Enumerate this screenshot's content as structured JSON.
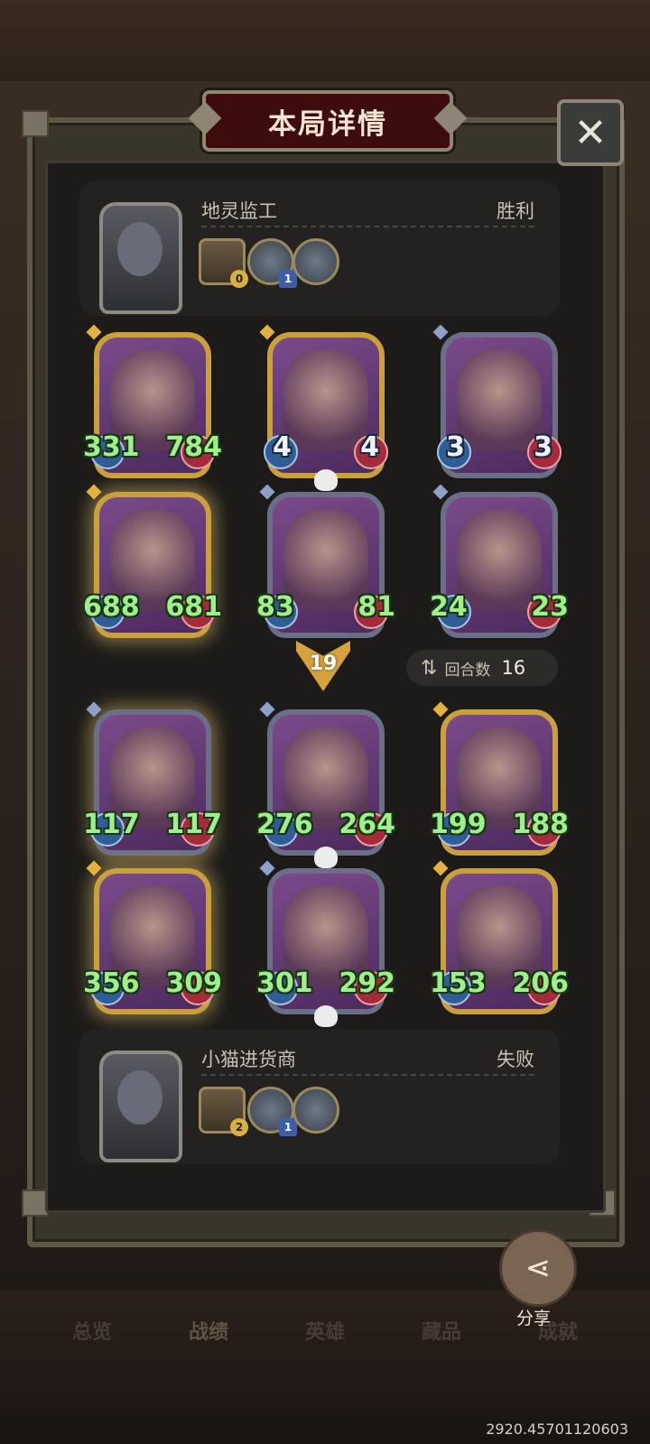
{
  "window": {
    "title": "本局详情"
  },
  "players": {
    "top": {
      "name": "地灵监工",
      "result": "胜利",
      "relics": [
        {
          "icon": "hero-frame-icon",
          "count": "0"
        },
        {
          "icon": "wrench-icon",
          "count": "1"
        },
        {
          "icon": "spider-icon",
          "count": ""
        }
      ]
    },
    "bottom": {
      "name": "小猫进货商",
      "result": "失败",
      "relics": [
        {
          "icon": "hero-frame-icon",
          "count": "2"
        },
        {
          "icon": "gear-icon",
          "count": "1"
        },
        {
          "icon": "statue-icon",
          "count": ""
        }
      ]
    }
  },
  "top_board": [
    {
      "atk": "331",
      "hp": "784",
      "skull": false
    },
    {
      "atk": "4",
      "hp": "4",
      "skull": true
    },
    {
      "atk": "3",
      "hp": "3",
      "skull": false
    },
    {
      "atk": "688",
      "hp": "681",
      "skull": false
    },
    {
      "atk": "83",
      "hp": "81",
      "skull": false
    },
    {
      "atk": "24",
      "hp": "23",
      "skull": false
    }
  ],
  "bottom_board": [
    {
      "atk": "117",
      "hp": "117",
      "skull": false
    },
    {
      "atk": "276",
      "hp": "264",
      "skull": true
    },
    {
      "atk": "199",
      "hp": "188",
      "skull": false
    },
    {
      "atk": "356",
      "hp": "309",
      "skull": false
    },
    {
      "atk": "301",
      "hp": "292",
      "skull": true
    },
    {
      "atk": "153",
      "hp": "206",
      "skull": false
    }
  ],
  "tier_marker": "19",
  "rounds": {
    "label": "回合数",
    "value": "16"
  },
  "share": {
    "label": "分享"
  },
  "tabs": [
    "总览",
    "战绩",
    "英雄",
    "藏品",
    "成就"
  ],
  "uid": "2920.45701120603"
}
